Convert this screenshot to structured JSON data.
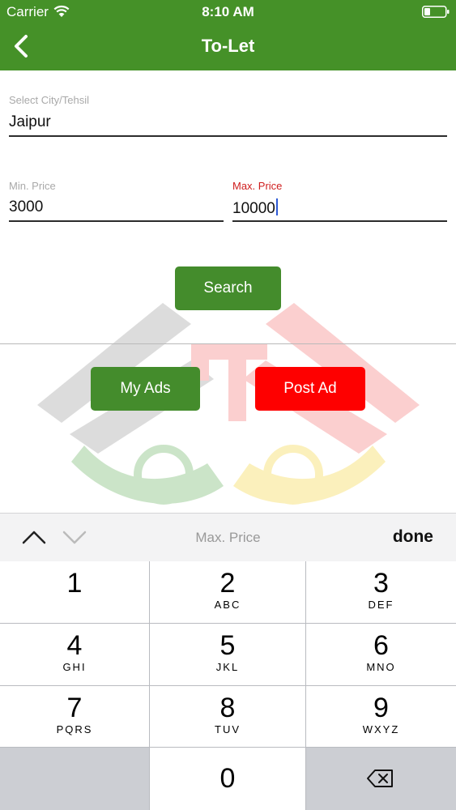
{
  "status_bar": {
    "carrier": "Carrier",
    "time": "8:10 AM"
  },
  "nav": {
    "title": "To-Let",
    "back_icon": "chevron-left-icon"
  },
  "form": {
    "city": {
      "label": "Select City/Tehsil",
      "value": "Jaipur"
    },
    "min_price": {
      "label": "Min. Price",
      "value": "3000"
    },
    "max_price": {
      "label": "Max. Price",
      "value": "10000"
    }
  },
  "buttons": {
    "search": "Search",
    "my_ads": "My Ads",
    "post_ad": "Post Ad"
  },
  "keyboard": {
    "accessory_title": "Max. Price",
    "done": "done",
    "keys": [
      {
        "digit": "1",
        "letters": ""
      },
      {
        "digit": "2",
        "letters": "ABC"
      },
      {
        "digit": "3",
        "letters": "DEF"
      },
      {
        "digit": "4",
        "letters": "GHI"
      },
      {
        "digit": "5",
        "letters": "JKL"
      },
      {
        "digit": "6",
        "letters": "MNO"
      },
      {
        "digit": "7",
        "letters": "PQRS"
      },
      {
        "digit": "8",
        "letters": "TUV"
      },
      {
        "digit": "9",
        "letters": "WXYZ"
      },
      {
        "digit": "0",
        "letters": ""
      }
    ]
  },
  "colors": {
    "header": "#459128",
    "green_button": "#448c2c",
    "red_button": "#fe0000",
    "active_label": "#cf1e1e"
  }
}
